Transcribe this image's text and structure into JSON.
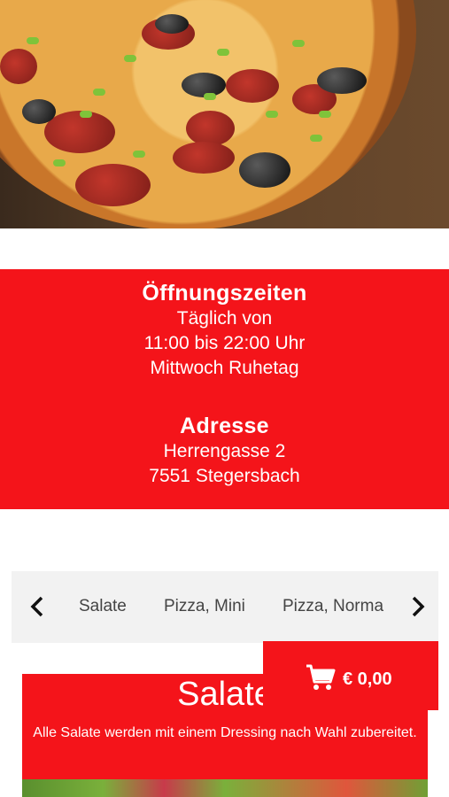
{
  "hours": {
    "heading": "Öffnungszeiten",
    "lines": [
      "Täglich von",
      "11:00 bis 22:00 Uhr",
      "Mittwoch Ruhetag"
    ]
  },
  "address": {
    "heading": "Adresse",
    "lines": [
      "Herrengasse 2",
      "7551 Stegersbach"
    ]
  },
  "categories": [
    "Salate",
    "Pizza, Mini",
    "Pizza, Norma"
  ],
  "cart": {
    "amount": "€ 0,00",
    "icon": "shopping-cart-icon"
  },
  "section": {
    "title": "Salate",
    "description": "Alle Salate werden mit einem Dressing nach Wahl zubereitet."
  },
  "colors": {
    "accent": "#f4141a",
    "nav_bg": "#f2f2f2"
  }
}
